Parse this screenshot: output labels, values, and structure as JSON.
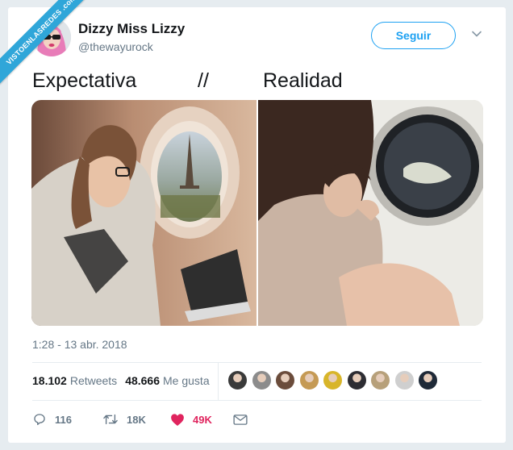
{
  "watermark": "VISTOENLASREDES .com",
  "author": {
    "name": "Dizzy Miss Lizzy",
    "handle": "@thewayurock",
    "avatar_icon": "avatar-pink-hair-sunglasses"
  },
  "follow_button": "Seguir",
  "menu_icon": "chevron-down-icon",
  "tweet": {
    "left": "Expectativa",
    "sep": "//",
    "right": "Realidad"
  },
  "media": [
    {
      "icon": "photo-woman-airplane-window-eiffel-tower"
    },
    {
      "icon": "photo-woman-washing-machine-window"
    }
  ],
  "timestamp": "1:28 - 13 abr. 2018",
  "stats": {
    "retweets_count": "18.102",
    "retweets_label": "Retweets",
    "likes_count": "48.666",
    "likes_label": "Me gusta"
  },
  "likers_count": 9,
  "actions": {
    "replies": "116",
    "retweets": "18K",
    "likes": "49K"
  },
  "colors": {
    "accent": "#1da1f2",
    "like": "#e0245e",
    "muted": "#657786",
    "ribbon": "#2fa6d9"
  }
}
